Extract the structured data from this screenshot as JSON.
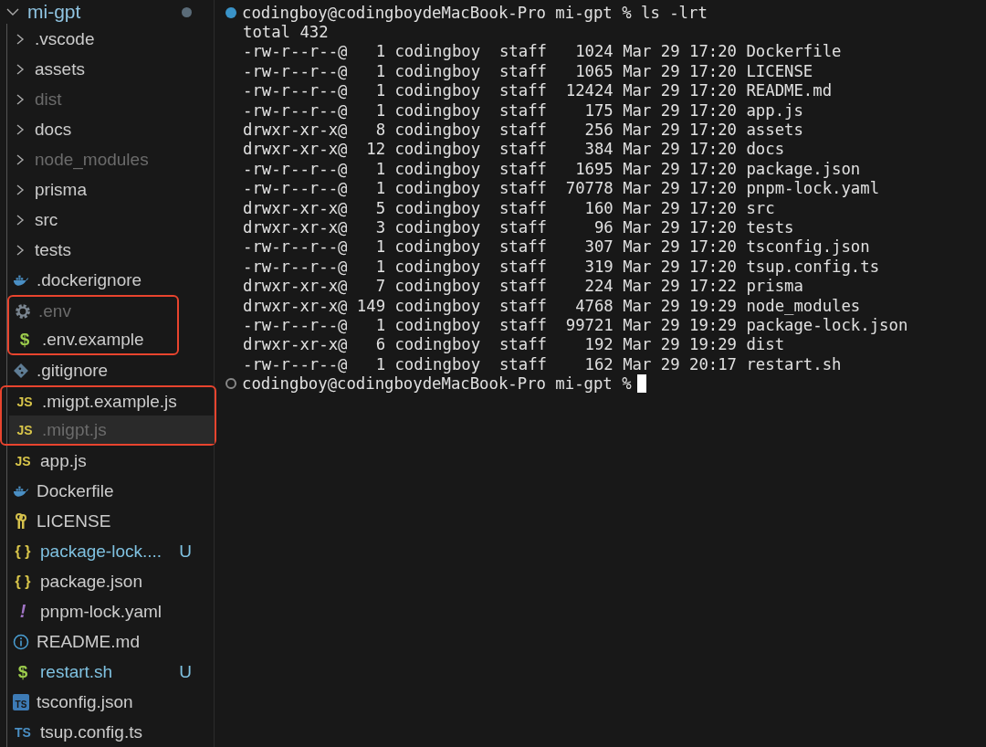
{
  "explorer": {
    "title": "mi-gpt",
    "expanded": true,
    "items": [
      {
        "kind": "folder",
        "name": ".vscode",
        "expanded": false,
        "dimmed": false,
        "boxed": false,
        "selected": false
      },
      {
        "kind": "folder",
        "name": "assets",
        "expanded": false,
        "dimmed": false,
        "boxed": false,
        "selected": false
      },
      {
        "kind": "folder",
        "name": "dist",
        "expanded": false,
        "dimmed": true,
        "boxed": false,
        "selected": false
      },
      {
        "kind": "folder",
        "name": "docs",
        "expanded": false,
        "dimmed": false,
        "boxed": false,
        "selected": false
      },
      {
        "kind": "folder",
        "name": "node_modules",
        "expanded": false,
        "dimmed": true,
        "boxed": false,
        "selected": false
      },
      {
        "kind": "folder",
        "name": "prisma",
        "expanded": false,
        "dimmed": false,
        "boxed": false,
        "selected": false
      },
      {
        "kind": "folder",
        "name": "src",
        "expanded": false,
        "dimmed": false,
        "boxed": false,
        "selected": false
      },
      {
        "kind": "folder",
        "name": "tests",
        "expanded": false,
        "dimmed": false,
        "boxed": false,
        "selected": false
      },
      {
        "kind": "docker",
        "name": ".dockerignore",
        "dimmed": false,
        "boxed": false,
        "selected": false
      },
      {
        "kind": "gear",
        "name": ".env",
        "dimmed": true,
        "boxed": true,
        "selected": false
      },
      {
        "kind": "dollar",
        "glyph": "$",
        "name": ".env.example",
        "dimmed": false,
        "boxed": true,
        "selected": false
      },
      {
        "kind": "git",
        "name": ".gitignore",
        "dimmed": false,
        "boxed": false,
        "selected": false
      },
      {
        "kind": "js",
        "glyph": "JS",
        "name": ".migpt.example.js",
        "dimmed": false,
        "boxed": true,
        "selected": false
      },
      {
        "kind": "js",
        "glyph": "JS",
        "name": ".migpt.js",
        "dimmed": true,
        "boxed": true,
        "selected": true
      },
      {
        "kind": "js",
        "glyph": "JS",
        "name": "app.js",
        "dimmed": false,
        "boxed": false,
        "selected": false
      },
      {
        "kind": "docker",
        "name": "Dockerfile",
        "dimmed": false,
        "boxed": false,
        "selected": false
      },
      {
        "kind": "key",
        "name": "LICENSE",
        "dimmed": false,
        "boxed": false,
        "selected": false
      },
      {
        "kind": "braces",
        "glyph": "{ }",
        "name": "package-lock....",
        "dimmed": false,
        "boxed": false,
        "selected": false,
        "status": "U"
      },
      {
        "kind": "braces",
        "glyph": "{ }",
        "name": "package.json",
        "dimmed": false,
        "boxed": false,
        "selected": false
      },
      {
        "kind": "exclaim",
        "glyph": "!",
        "name": "pnpm-lock.yaml",
        "dimmed": false,
        "boxed": false,
        "selected": false
      },
      {
        "kind": "info",
        "name": "README.md",
        "dimmed": false,
        "boxed": false,
        "selected": false
      },
      {
        "kind": "dollar",
        "glyph": "$",
        "name": "restart.sh",
        "dimmed": false,
        "boxed": false,
        "selected": false,
        "status": "U"
      },
      {
        "kind": "tsbox",
        "glyph": "TS",
        "name": "tsconfig.json",
        "dimmed": false,
        "boxed": false,
        "selected": false
      },
      {
        "kind": "ts",
        "glyph": "TS",
        "name": "tsup.config.ts",
        "dimmed": false,
        "boxed": false,
        "selected": false
      }
    ]
  },
  "terminal": {
    "lines": [
      {
        "kind": "prompt",
        "text": "codingboy@codingboydeMacBook-Pro mi-gpt % ls -lrt",
        "finished": true,
        "cursor": false
      },
      {
        "kind": "output",
        "text": "total 432"
      },
      {
        "kind": "output",
        "text": "-rw-r--r--@   1 codingboy  staff   1024 Mar 29 17:20 Dockerfile"
      },
      {
        "kind": "output",
        "text": "-rw-r--r--@   1 codingboy  staff   1065 Mar 29 17:20 LICENSE"
      },
      {
        "kind": "output",
        "text": "-rw-r--r--@   1 codingboy  staff  12424 Mar 29 17:20 README.md"
      },
      {
        "kind": "output",
        "text": "-rw-r--r--@   1 codingboy  staff    175 Mar 29 17:20 app.js"
      },
      {
        "kind": "output",
        "text": "drwxr-xr-x@   8 codingboy  staff    256 Mar 29 17:20 assets"
      },
      {
        "kind": "output",
        "text": "drwxr-xr-x@  12 codingboy  staff    384 Mar 29 17:20 docs"
      },
      {
        "kind": "output",
        "text": "-rw-r--r--@   1 codingboy  staff   1695 Mar 29 17:20 package.json"
      },
      {
        "kind": "output",
        "text": "-rw-r--r--@   1 codingboy  staff  70778 Mar 29 17:20 pnpm-lock.yaml"
      },
      {
        "kind": "output",
        "text": "drwxr-xr-x@   5 codingboy  staff    160 Mar 29 17:20 src"
      },
      {
        "kind": "output",
        "text": "drwxr-xr-x@   3 codingboy  staff     96 Mar 29 17:20 tests"
      },
      {
        "kind": "output",
        "text": "-rw-r--r--@   1 codingboy  staff    307 Mar 29 17:20 tsconfig.json"
      },
      {
        "kind": "output",
        "text": "-rw-r--r--@   1 codingboy  staff    319 Mar 29 17:20 tsup.config.ts"
      },
      {
        "kind": "output",
        "text": "drwxr-xr-x@   7 codingboy  staff    224 Mar 29 17:22 prisma"
      },
      {
        "kind": "output",
        "text": "drwxr-xr-x@ 149 codingboy  staff   4768 Mar 29 19:29 node_modules"
      },
      {
        "kind": "output",
        "text": "-rw-r--r--@   1 codingboy  staff  99721 Mar 29 19:29 package-lock.json"
      },
      {
        "kind": "output",
        "text": "drwxr-xr-x@   6 codingboy  staff    192 Mar 29 19:29 dist"
      },
      {
        "kind": "output",
        "text": "-rw-r--r--@   1 codingboy  staff    162 Mar 29 20:17 restart.sh"
      },
      {
        "kind": "prompt",
        "text": "codingboy@codingboydeMacBook-Pro mi-gpt %",
        "finished": false,
        "cursor": true
      }
    ]
  }
}
